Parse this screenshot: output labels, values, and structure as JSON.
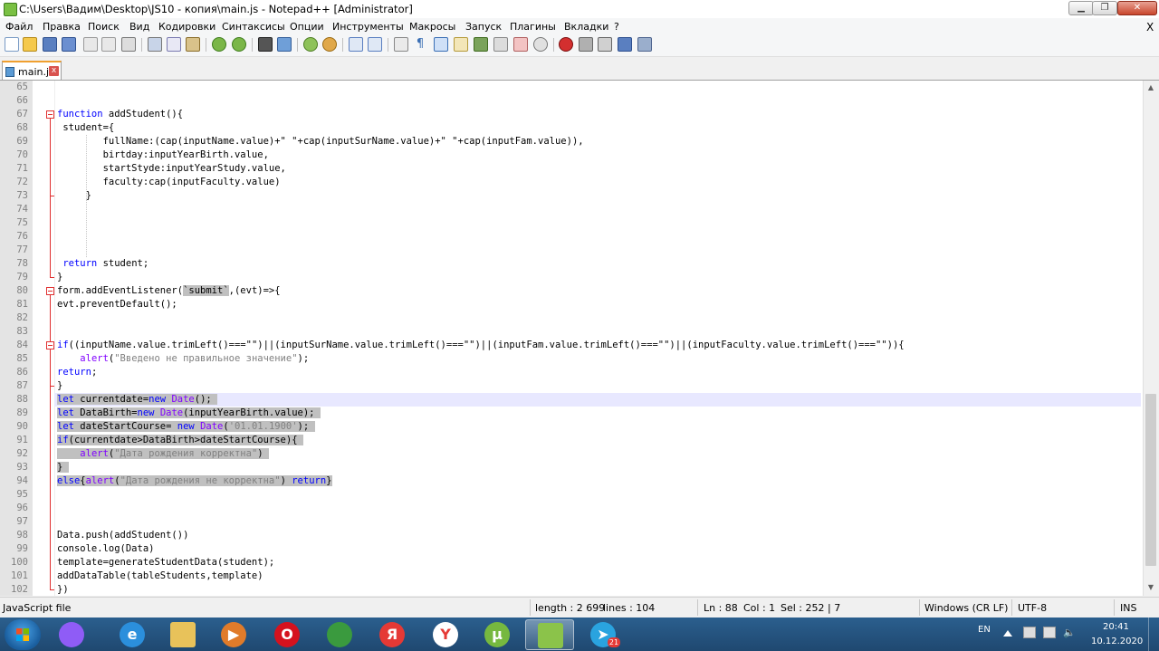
{
  "window": {
    "title": "C:\\Users\\Вадим\\Desktop\\JS10 - копия\\main.js - Notepad++ [Administrator]",
    "controls": {
      "minimize": "▁",
      "maximize": "❐",
      "close": "✕"
    }
  },
  "menu": {
    "items": [
      "Файл",
      "Правка",
      "Поиск",
      "Вид",
      "Кодировки",
      "Синтаксисы",
      "Опции",
      "Инструменты",
      "Макросы",
      "Запуск",
      "Плагины",
      "Вкладки",
      "?"
    ],
    "close": "X"
  },
  "tab": {
    "label": "main.js",
    "close": "x"
  },
  "editor": {
    "current_line": 88,
    "lines": [
      {
        "n": "65"
      },
      {
        "n": "66"
      },
      {
        "n": "67",
        "html": "<span class=\"kw\">function</span> addStudent(){"
      },
      {
        "n": "68",
        "html": " student={"
      },
      {
        "n": "69",
        "html": "        fullName:(cap(inputName.value)+\" \"+cap(inputSurName.value)+\" \"+cap(inputFam.value)),"
      },
      {
        "n": "70",
        "html": "        birtday:inputYearBirth.value,"
      },
      {
        "n": "71",
        "html": "        startStyde:inputYearStudy.value,"
      },
      {
        "n": "72",
        "html": "        faculty:cap(inputFaculty.value)"
      },
      {
        "n": "73",
        "html": "     }"
      },
      {
        "n": "74"
      },
      {
        "n": "75"
      },
      {
        "n": "76"
      },
      {
        "n": "77"
      },
      {
        "n": "78",
        "html": " <span class=\"kw\">return</span> student;"
      },
      {
        "n": "79",
        "html": "}"
      },
      {
        "n": "80",
        "html": "form.addEventListener(<span class=\"sel\">`submit`</span>,(evt)=>{"
      },
      {
        "n": "81",
        "html": "evt.preventDefault();"
      },
      {
        "n": "82"
      },
      {
        "n": "83"
      },
      {
        "n": "84",
        "html": "<span class=\"kw\">if</span>((inputName.value.trimLeft()===\"\")||(inputSurName.value.trimLeft()===\"\")||(inputFam.value.trimLeft()===\"\")||(inputFaculty.value.trimLeft()===\"\")){"
      },
      {
        "n": "85",
        "html": "    <span class=\"obj\">alert</span>(<span class=\"str\">\"Введено не правильное значение\"</span>);"
      },
      {
        "n": "86",
        "html": "<span class=\"kw\">return</span>;"
      },
      {
        "n": "87",
        "html": "}"
      },
      {
        "n": "88",
        "html": "<span class=\"sel\"><span class=\"kw\">let</span> currentdate=<span class=\"kw\">new</span> <span class=\"obj\">Date</span>(); </span>"
      },
      {
        "n": "89",
        "html": "<span class=\"sel\"><span class=\"kw\">let</span> DataBirth=<span class=\"kw\">new</span> <span class=\"obj\">Date</span>(inputYearBirth.value); </span>"
      },
      {
        "n": "90",
        "html": "<span class=\"sel\"><span class=\"kw\">let</span> dateStartCourse= <span class=\"kw\">new</span> <span class=\"obj\">Date</span>(<span class=\"str\">'01.01.1900'</span>); </span>"
      },
      {
        "n": "91",
        "html": "<span class=\"sel\"><span class=\"kw\">if</span>(currentdate>DataBirth>dateStartCourse){ </span>"
      },
      {
        "n": "92",
        "html": "<span class=\"sel\">    <span class=\"obj\">alert</span>(<span class=\"str\">\"Дата рождения корректна\"</span>) </span>"
      },
      {
        "n": "93",
        "html": "<span class=\"sel\">} </span>"
      },
      {
        "n": "94",
        "html": "<span class=\"sel\"><span class=\"kw\">else</span>{<span class=\"obj\">alert</span>(<span class=\"str\">\"Дата рождения не корректна\"</span>) <span class=\"kw\">return</span>}</span>"
      },
      {
        "n": "95"
      },
      {
        "n": "96"
      },
      {
        "n": "97"
      },
      {
        "n": "98",
        "html": "Data.push(addStudent())"
      },
      {
        "n": "99",
        "html": "console.log(Data)"
      },
      {
        "n": "100",
        "html": "template=generateStudentData(student);"
      },
      {
        "n": "101",
        "html": "addDataTable(tableStudents,template)"
      },
      {
        "n": "102",
        "html": "})"
      }
    ]
  },
  "status": {
    "language": "JavaScript file",
    "length": "length : 2 699",
    "lines": "lines : 104",
    "ln": "Ln : 88",
    "col": "Col : 1",
    "sel": "Sel : 252 | 7",
    "eol": "Windows (CR LF)",
    "encoding": "UTF-8",
    "mode": "INS"
  },
  "taskbar": {
    "apps": [
      {
        "name": "alice-icon",
        "color": "#8f5cf6",
        "glyph": ""
      },
      {
        "name": "ie-icon",
        "color": "#2b8fdc",
        "glyph": "e"
      },
      {
        "name": "explorer-icon",
        "color": "#e8c25a",
        "glyph": ""
      },
      {
        "name": "media-player-icon",
        "color": "#e07b2a",
        "glyph": "▶"
      },
      {
        "name": "opera-icon",
        "color": "#d5121e",
        "glyph": "O"
      },
      {
        "name": "chrome-icon",
        "color": "#3a9a3e",
        "glyph": ""
      },
      {
        "name": "yandex-icon",
        "color": "#e53935",
        "glyph": "Я"
      },
      {
        "name": "yandex-browser-icon",
        "color": "#ffffff",
        "glyph": "Y"
      },
      {
        "name": "utorrent-icon",
        "color": "#76b83f",
        "glyph": "µ"
      },
      {
        "name": "notepadpp-icon",
        "color": "#8bc34a",
        "glyph": ""
      },
      {
        "name": "telegram-icon",
        "color": "#2aa3df",
        "glyph": "➤"
      }
    ],
    "telegram_badge": "21",
    "tray": {
      "lang": "EN",
      "time": "20:41",
      "date": "10.12.2020"
    }
  }
}
